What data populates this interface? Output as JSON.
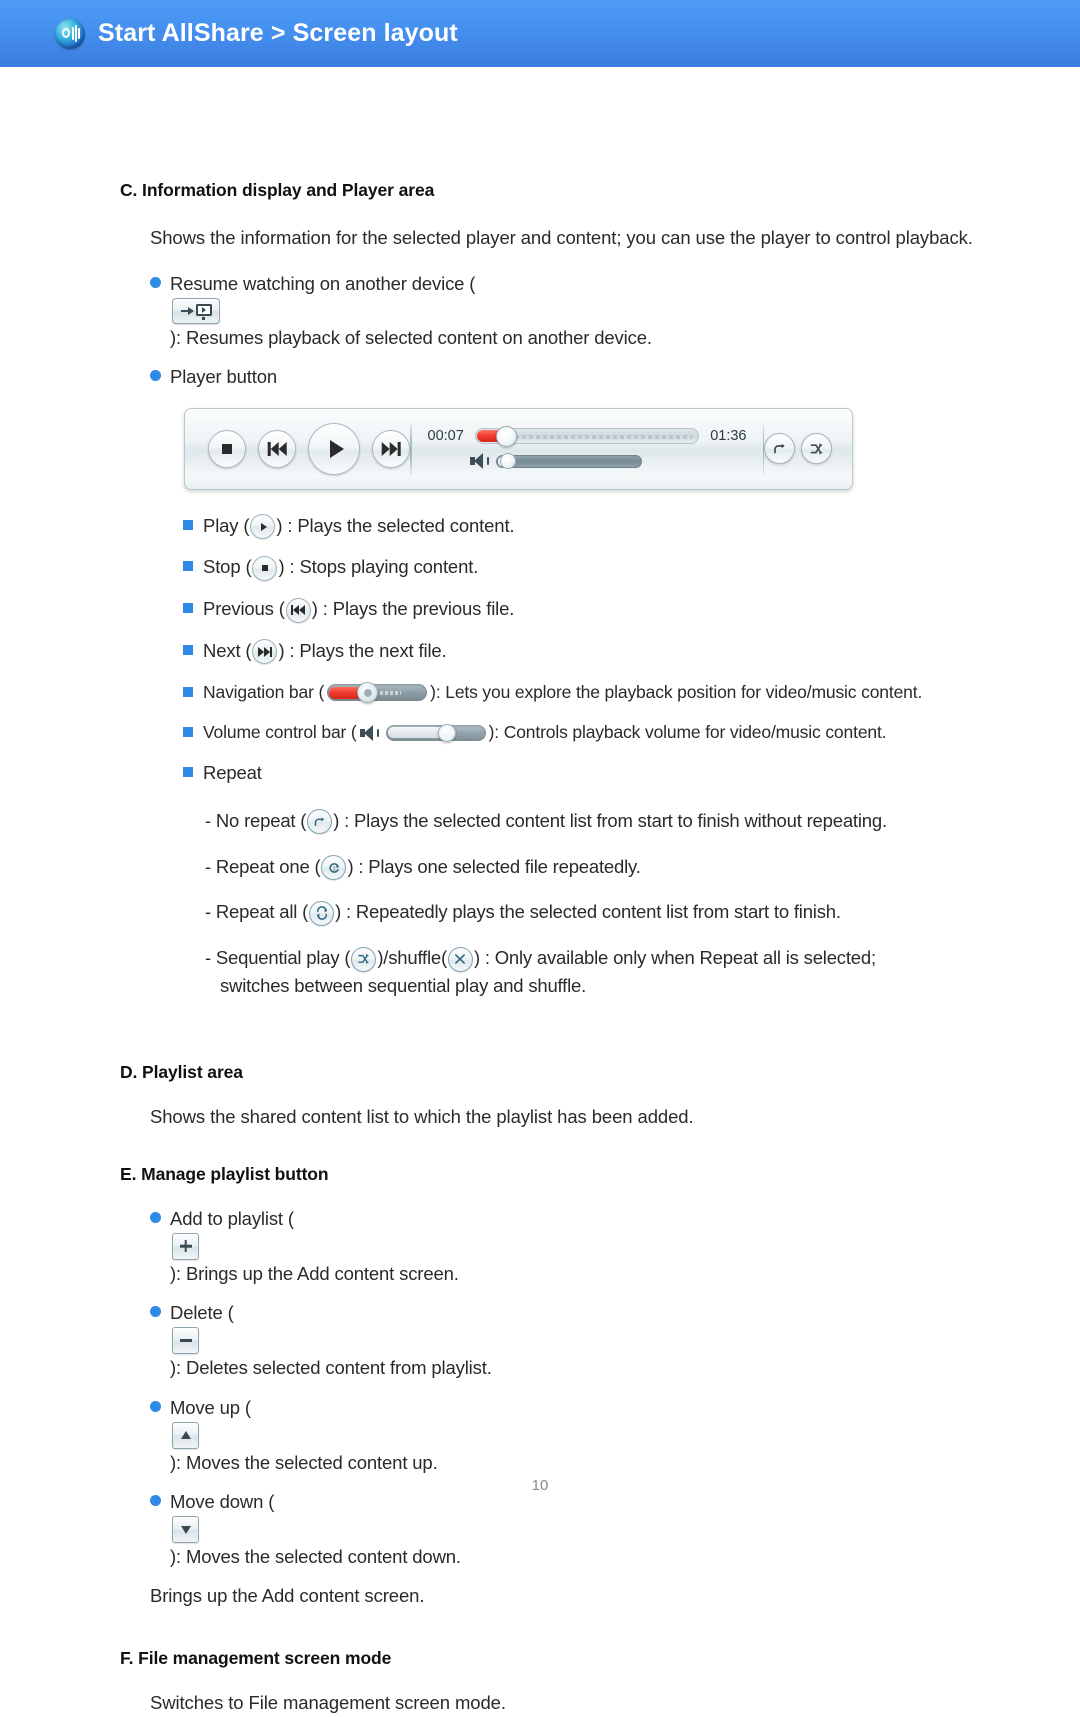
{
  "header": {
    "title": "Start AllShare > Screen layout",
    "logo_icon": "allshare-logo-icon",
    "bg_from": "#4e9cf6",
    "bg_to": "#3b7ce0"
  },
  "sections": {
    "c": {
      "heading": "C. Information display and Player area",
      "intro": "Shows the information for the selected player and content; you can use the player to control playback.",
      "resume": {
        "pre": "Resume watching on another device  (",
        "icon": "resume-on-device-icon",
        "post": "): Resumes playback of selected content on another device."
      },
      "player_button_label": "Player button",
      "player_bar": {
        "stop_icon": "stop-icon",
        "previous_icon": "previous-icon",
        "play_icon": "play-icon",
        "next_icon": "next-icon",
        "elapsed_time": "00:07",
        "total_time": "01:36",
        "progress_percent": 7,
        "volume_percent": 8,
        "repeat_icon": "no-repeat-icon",
        "shuffle_icon": "sequential-play-icon"
      },
      "items": [
        {
          "pre": "Play (",
          "icon": "play-icon",
          "post": ") : Plays the selected content."
        },
        {
          "pre": "Stop (",
          "icon": "stop-icon",
          "post": ") : Stops playing content."
        },
        {
          "pre": "Previous (",
          "icon": "previous-icon",
          "post": ") :  Plays the previous file."
        },
        {
          "pre": "Next (",
          "icon": "next-icon",
          "post": ") :  Plays the next file."
        },
        {
          "pre": "Navigation bar (",
          "icon": "navigation-bar-icon",
          "post": "): Lets you explore the playback position for video/music content."
        },
        {
          "pre": "Volume control bar (",
          "icon": "volume-control-bar-icon",
          "post": "): Controls playback volume for video/music content."
        },
        {
          "pre": "Repeat",
          "icon": "",
          "post": ""
        }
      ],
      "repeat_items": [
        {
          "pre": "- No repeat (",
          "icon": "no-repeat-icon",
          "post": ") : Plays the selected content list from start to finish without repeating."
        },
        {
          "pre": "- Repeat one (",
          "icon": "repeat-one-icon",
          "post": ") :  Plays one selected file repeatedly."
        },
        {
          "pre": "- Repeat all (",
          "icon": "repeat-all-icon",
          "post": ") : Repeatedly plays the selected content list from start to finish."
        }
      ],
      "sequential": {
        "pre": "- Sequential play (",
        "icon1": "sequential-play-icon",
        "mid": ")/shuffle(",
        "icon2": "shuffle-icon",
        "post": ") : Only available only when Repeat all is selected;",
        "post2": "switches between sequential play and shuffle."
      }
    },
    "d": {
      "heading": "D. Playlist area",
      "body": "Shows the shared content list to which the playlist has been added."
    },
    "e": {
      "heading": "E. Manage playlist button",
      "items": [
        {
          "pre": "Add to playlist (",
          "icon": "add-to-playlist-icon",
          "post": "): Brings up the Add content screen."
        },
        {
          "pre": "Delete (",
          "icon": "delete-icon",
          "post": "): Deletes selected content from playlist."
        },
        {
          "pre": "Move up (",
          "icon": "move-up-icon",
          "post": "): Moves the selected content up."
        },
        {
          "pre": "Move down (",
          "icon": "move-down-icon",
          "post": "): Moves the selected content down."
        }
      ],
      "trailing_note": "Brings up the Add content screen."
    },
    "f": {
      "heading": "F. File management screen mode",
      "body": "Switches to File management screen mode."
    }
  },
  "footer": {
    "page_number": "10"
  }
}
